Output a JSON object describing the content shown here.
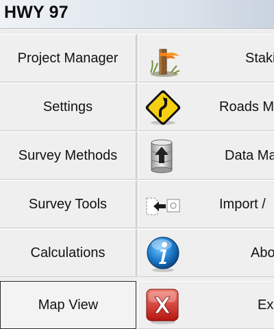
{
  "app": {
    "title": "HWY 97"
  },
  "menu": {
    "left": [
      {
        "label": "Project Manager"
      },
      {
        "label": "Settings"
      },
      {
        "label": "Survey Methods"
      },
      {
        "label": "Survey Tools"
      },
      {
        "label": "Calculations"
      },
      {
        "label": "Map View"
      }
    ],
    "right": [
      {
        "label": "Staki",
        "icon": "stake-icon"
      },
      {
        "label": "Roads M",
        "icon": "road-sign-icon"
      },
      {
        "label": "Data Ma",
        "icon": "database-upload-icon"
      },
      {
        "label": "Import /",
        "icon": "import-icon"
      },
      {
        "label": "Abo",
        "icon": "info-icon"
      },
      {
        "label": "Exi",
        "icon": "exit-icon"
      }
    ]
  }
}
